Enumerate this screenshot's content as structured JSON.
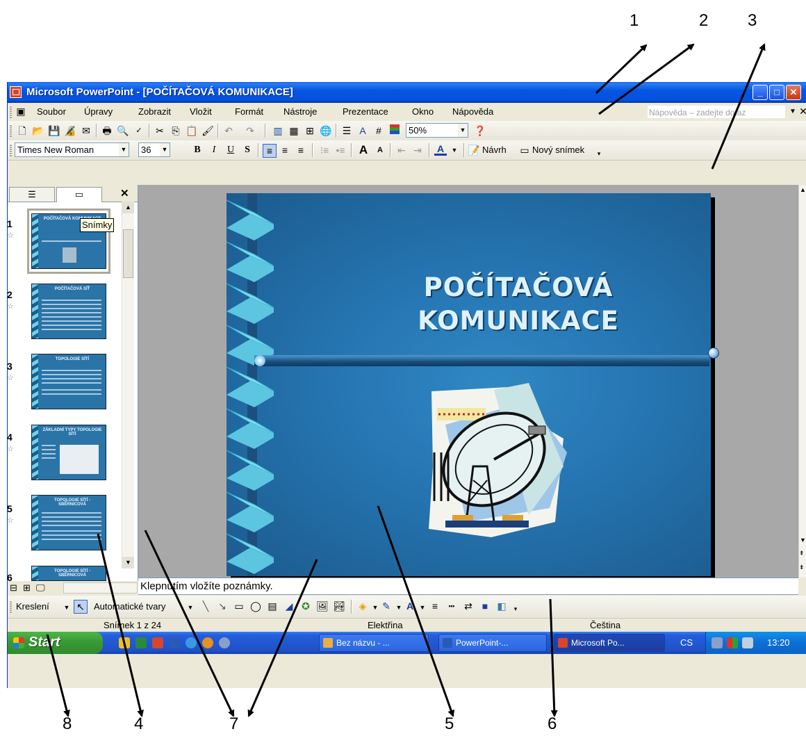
{
  "callouts": [
    "1",
    "2",
    "3",
    "4",
    "5",
    "6",
    "7",
    "7",
    "8"
  ],
  "window": {
    "title": "Microsoft PowerPoint - [POČÍTAČOVÁ KOMUNIKACE]"
  },
  "menu": {
    "items": [
      "Soubor",
      "Úpravy",
      "Zobrazit",
      "Vložit",
      "Formát",
      "Nástroje",
      "Prezentace",
      "Okno",
      "Nápověda"
    ],
    "help_placeholder": "Nápověda – zadejte dotaz"
  },
  "standard_toolbar": {
    "zoom": "50%"
  },
  "formatting_toolbar": {
    "font": "Times New Roman",
    "size": "36",
    "design_label": "Návrh",
    "new_slide_label": "Nový snímek"
  },
  "left_pane": {
    "tooltip": "Snímky",
    "slides": [
      {
        "number": "1",
        "title": "POČÍTAČOVÁ KOMUNIKACE"
      },
      {
        "number": "2",
        "title": "POČÍTAČOVÁ SÍŤ"
      },
      {
        "number": "3",
        "title": "TOPOLOGIE SÍTÍ"
      },
      {
        "number": "4",
        "title": "ZÁKLADNÍ TYPY TOPOLOGIE SÍTÍ"
      },
      {
        "number": "5",
        "title": "TOPOLOGIE SÍTÍ - SBĚRNICOVÁ"
      },
      {
        "number": "6",
        "title": "TOPOLOGIE SÍTÍ - SBĚRNICOVÁ"
      }
    ]
  },
  "slide": {
    "title_line1": "POČÍTAČOVÁ",
    "title_line2": "KOMUNIKACE"
  },
  "notes": {
    "placeholder": "Klepnutím vložíte poznámky."
  },
  "drawing_toolbar": {
    "draw_label": "Kreslení",
    "autoshapes_label": "Automatické tvary"
  },
  "status_bar": {
    "slide_info": "Snímek 1 z 24",
    "design": "Elektřina",
    "language": "Čeština"
  },
  "taskbar": {
    "start": "Start",
    "tasks": [
      "Bez názvu - ...",
      "PowerPoint-...",
      "Microsoft Po..."
    ],
    "language": "CS",
    "clock": "13:20"
  }
}
